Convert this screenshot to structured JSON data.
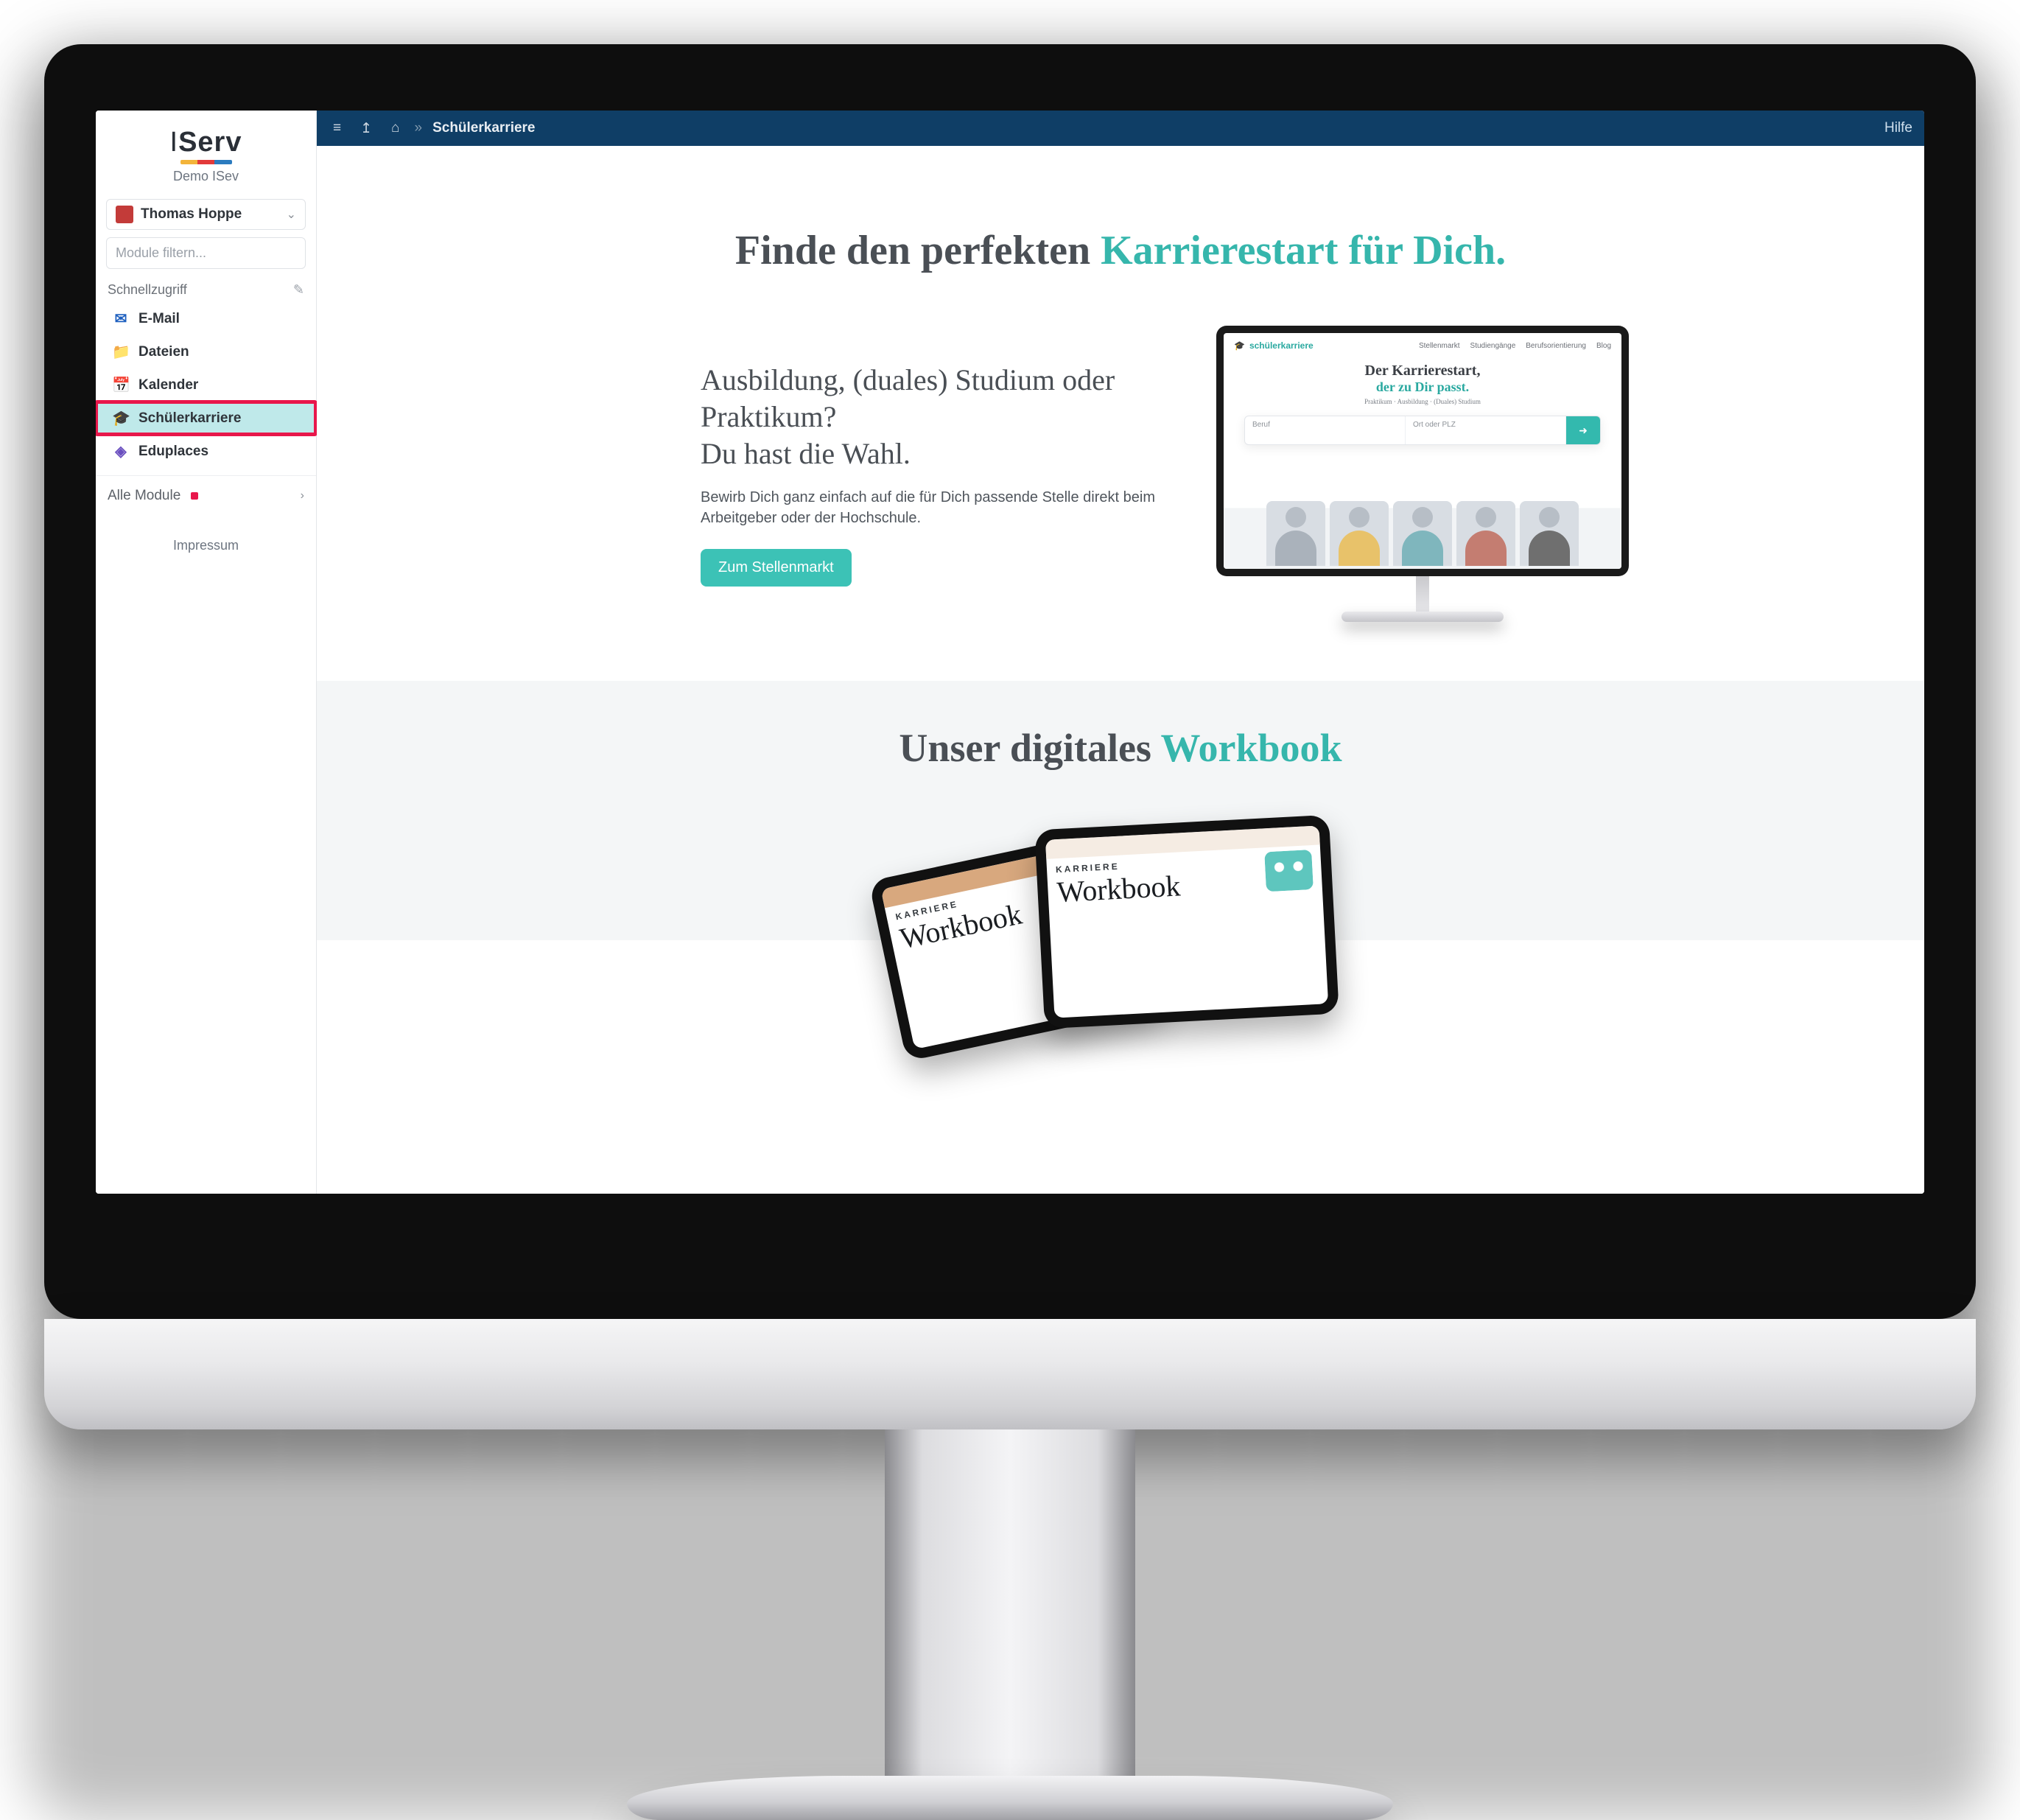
{
  "brand": {
    "logo": "IServ",
    "subtitle": "Demo ISev"
  },
  "user": {
    "name": "Thomas Hoppe"
  },
  "sidebar": {
    "filter_placeholder": "Module filtern...",
    "quick_label": "Schnellzugriff",
    "items": [
      {
        "id": "email",
        "label": "E-Mail",
        "icon": "mail"
      },
      {
        "id": "dateien",
        "label": "Dateien",
        "icon": "folder"
      },
      {
        "id": "kalender",
        "label": "Kalender",
        "icon": "calendar"
      },
      {
        "id": "schuelerkarriere",
        "label": "Schülerkarriere",
        "icon": "cap",
        "active": true
      },
      {
        "id": "eduplaces",
        "label": "Eduplaces",
        "icon": "edu"
      }
    ],
    "all_modules_label": "Alle Module",
    "imprint_label": "Impressum"
  },
  "topbar": {
    "crumb": "Schülerkarriere",
    "help_label": "Hilfe"
  },
  "hero": {
    "title_plain": "Finde den perfekten ",
    "title_accent": "Karrierestart für Dich.",
    "subtitle": "Ausbildung, (duales) Studium oder Praktikum?\nDu hast die Wahl.",
    "description": "Bewirb Dich ganz einfach auf die für Dich passende Stelle direkt beim Arbeitgeber oder der Hochschule.",
    "cta_label": "Zum Stellenmarkt"
  },
  "mini": {
    "brand": "schülerkarriere",
    "nav": [
      "Stellenmarkt",
      "Studiengänge",
      "Berufsorientierung",
      "Blog"
    ],
    "headline": "Der Karrierestart,",
    "headline_accent": "der zu Dir passt.",
    "tagline": "Praktikum · Ausbildung · (Duales) Studium",
    "search_left": "Beruf",
    "search_right": "Ort oder PLZ"
  },
  "section2": {
    "title_plain": "Unser digitales ",
    "title_accent": "Workbook",
    "wb_label": "KARRIERE",
    "wb_script": "Workbook"
  },
  "colors": {
    "accent": "#36b6ac",
    "brandBar": "#0f3e66",
    "highlight": "#e8174b"
  }
}
